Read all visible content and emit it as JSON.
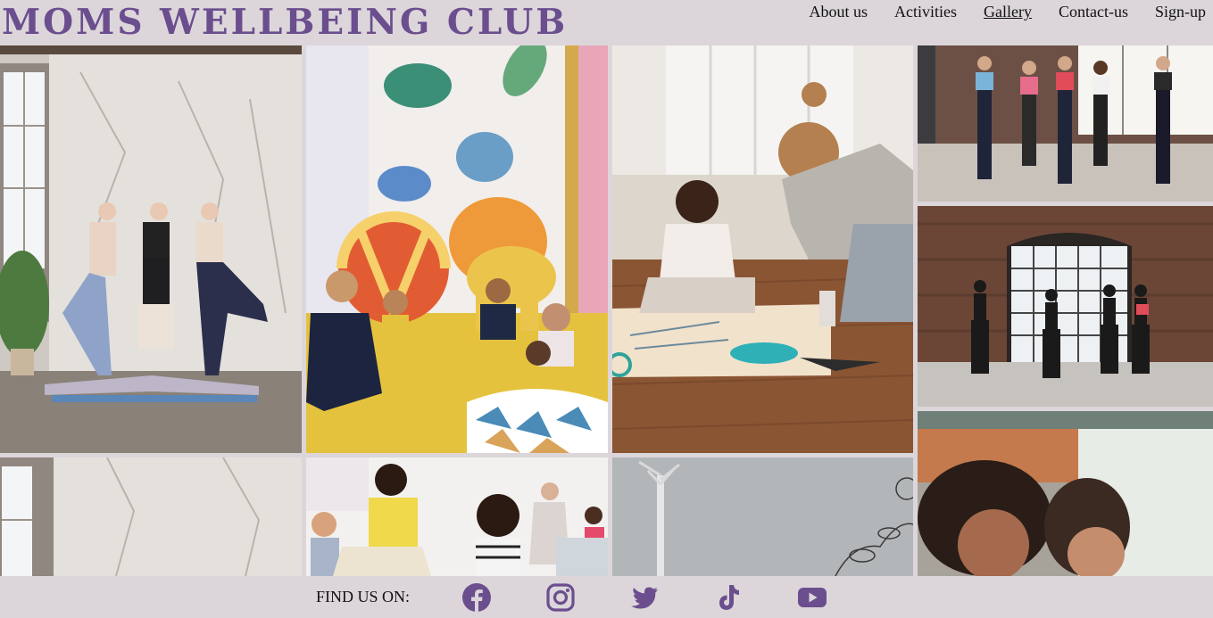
{
  "brand": "MOMS WELLBEING CLUB",
  "nav": {
    "items": [
      {
        "label": "About us"
      },
      {
        "label": "Activities"
      },
      {
        "label": "Gallery"
      },
      {
        "label": "Contact-us"
      },
      {
        "label": "Sign-up"
      }
    ]
  },
  "footer": {
    "find_label": "FIND US ON:",
    "icons": [
      "facebook-icon",
      "instagram-icon",
      "twitter-icon",
      "tiktok-icon",
      "youtube-icon"
    ]
  },
  "colors": {
    "brand": "#6b4e8e",
    "background": "#dcd6da",
    "icon": "#6b4e8e"
  }
}
